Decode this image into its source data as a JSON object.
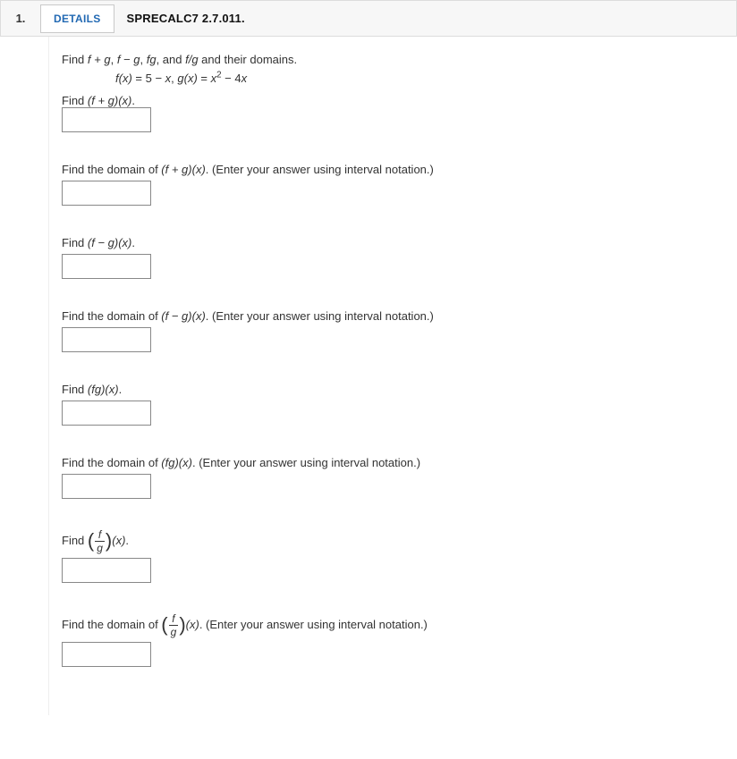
{
  "question_number": "1.",
  "details_label": "DETAILS",
  "question_ref": "SPRECALC7 2.7.011.",
  "intro_prefix": "Find ",
  "intro_suffix": " and their domains.",
  "f_def_lhs": "f(x)",
  "eq": " = ",
  "f_def_rhs_a": "5 − ",
  "f_def_rhs_b": "x",
  "g_def_lhs": "g(x)",
  "g_def_rhs_a": "x",
  "g_def_rhs_b": " − 4",
  "g_def_rhs_c": "x",
  "sep": ",   ",
  "find_word": "Find ",
  "find_domain_prefix": "Find the domain of ",
  "interval_suffix": ". (Enter your answer using interval notation.)",
  "dot": ".",
  "fplusg": "f + g",
  "fminusg": "f − g",
  "fg": "fg",
  "fover_g": "f/g",
  "comma_sp": ", ",
  "and_sp": ", and ",
  "op_fplusg": "(f + g)(x)",
  "op_fminusg": "(f − g)(x)",
  "op_fg": "(fg)(x)",
  "frac_f": "f",
  "frac_g": "g",
  "of_x": "(x)",
  "sup2": "2"
}
